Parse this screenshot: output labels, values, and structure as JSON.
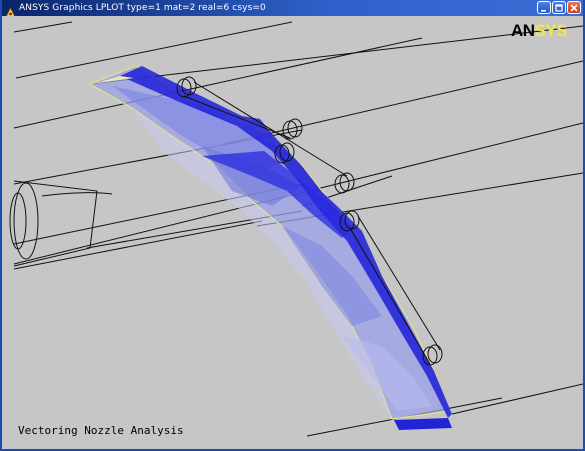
{
  "window": {
    "title": "ANSYS Graphics   LPLOT   type=1 mat=2 real=6 csys=0"
  },
  "logo": {
    "part1": "AN",
    "part2": "SYS"
  },
  "caption": "Vectoring Nozzle Analysis",
  "colors": {
    "titlebar": "#0a246a",
    "background": "#c6c6c6",
    "surface_fill": "#8f96e8",
    "edge_blue": "#1f1fd6",
    "edge_yellow": "#d8d87a",
    "logo_yellow": "#f2e84a"
  },
  "icons": [
    "ansys-app-icon",
    "minimize-icon",
    "maximize-icon",
    "close-icon"
  ]
}
